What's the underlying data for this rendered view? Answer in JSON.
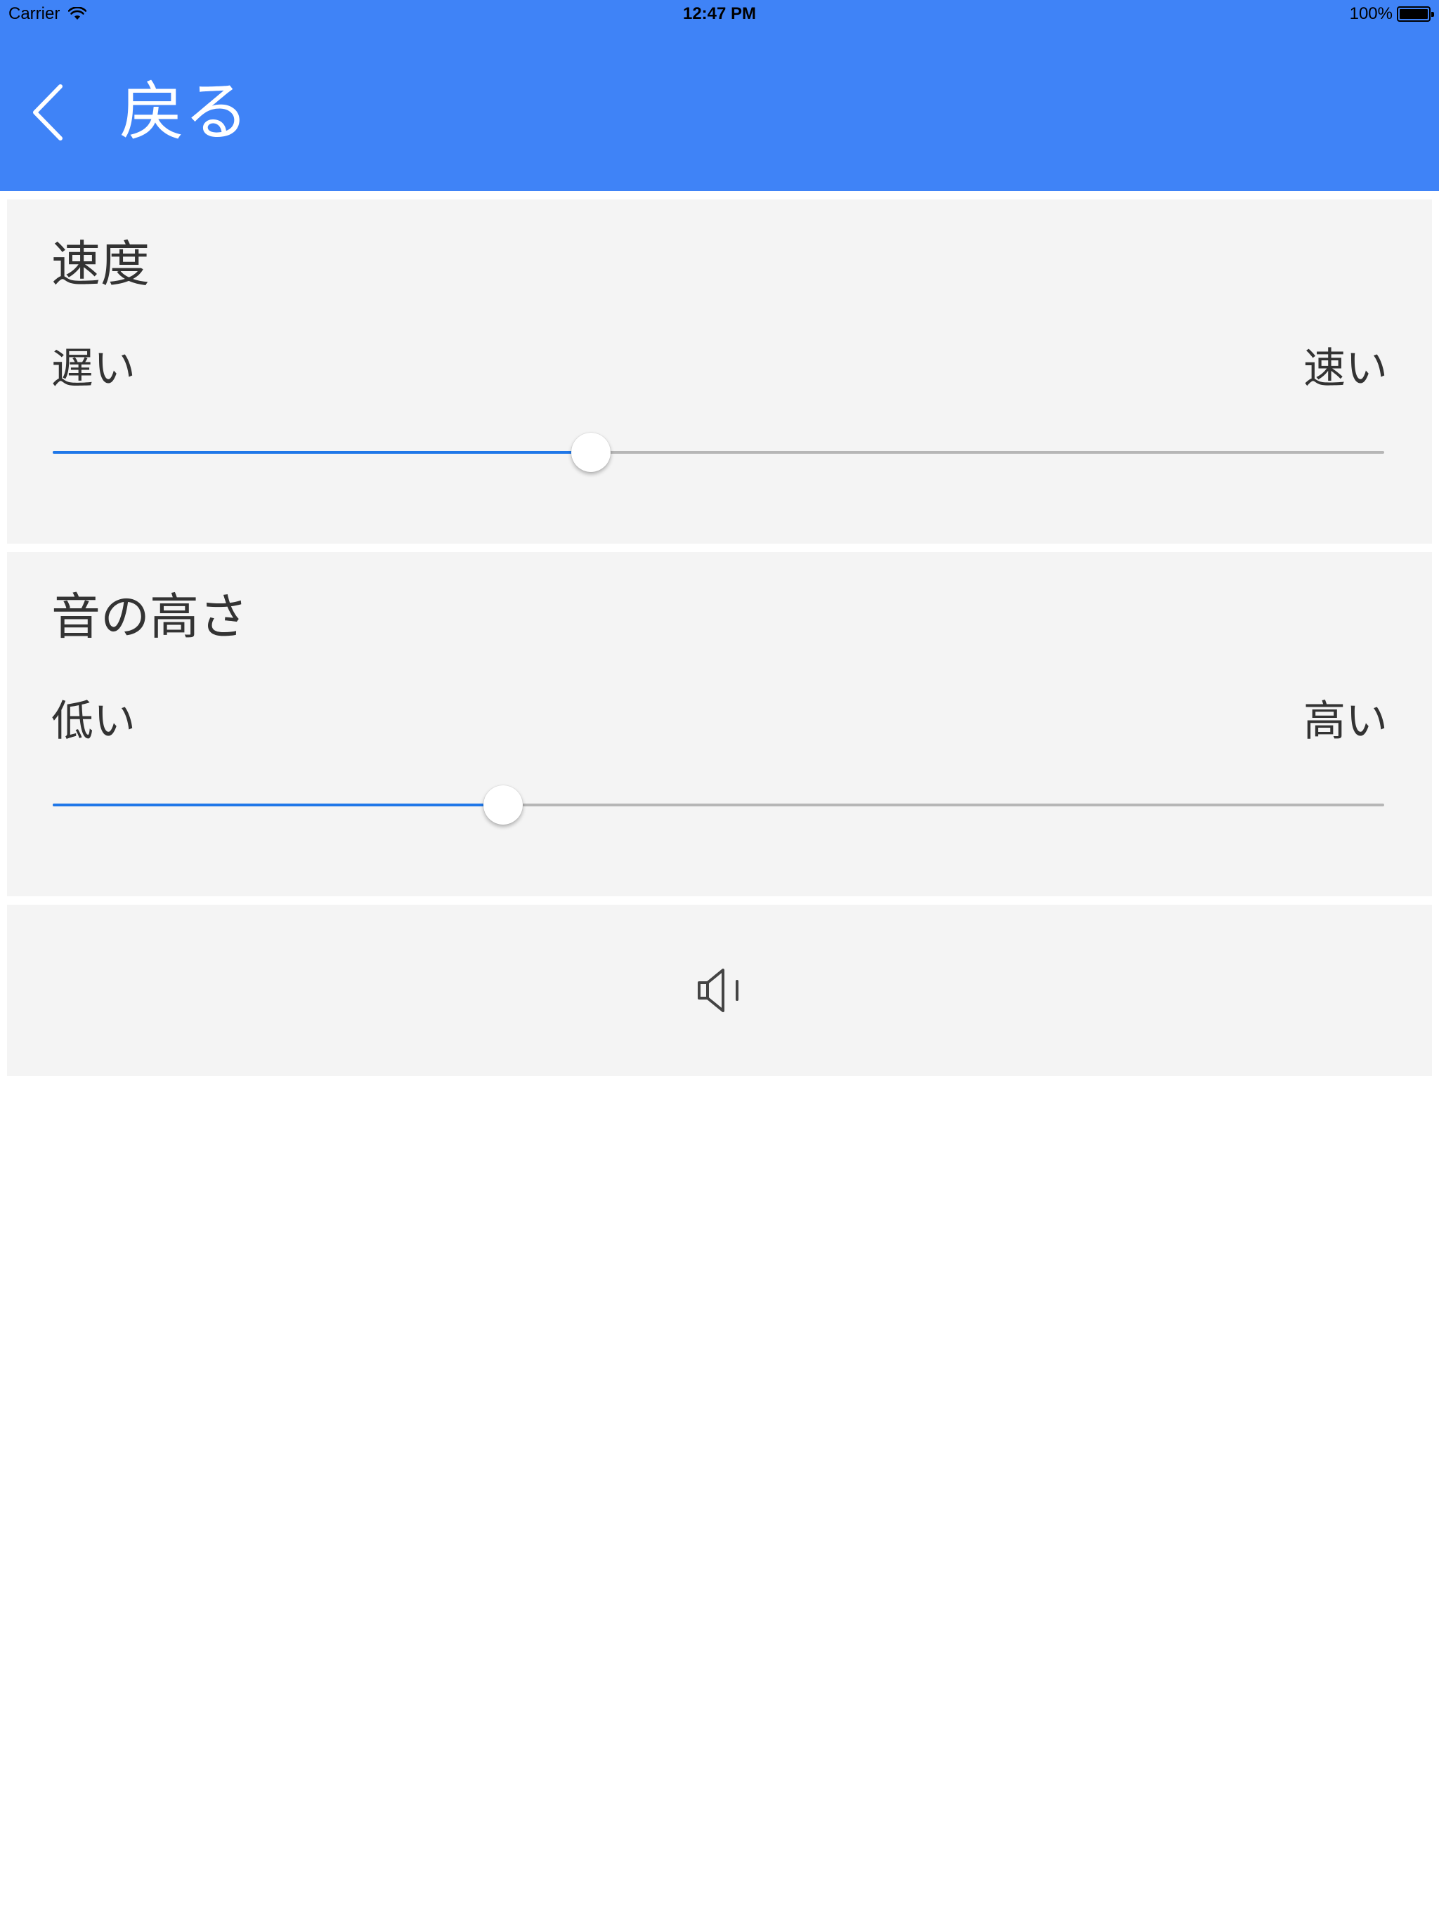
{
  "status_bar": {
    "carrier": "Carrier",
    "time": "12:47 PM",
    "battery": "100%"
  },
  "nav": {
    "back_label": "戻る",
    "back_icon": "chevron-left-icon",
    "color": "#3f83f7"
  },
  "speed": {
    "title": "速度",
    "min_label": "遅い",
    "max_label": "速い",
    "value": 0.404
  },
  "pitch": {
    "title": "音の高さ",
    "min_label": "低い",
    "max_label": "高い",
    "value": 0.338
  },
  "play": {
    "icon": "speaker-icon"
  },
  "colors": {
    "accent": "#3f83f7",
    "slider_fill": "#1f77e8",
    "slider_track": "#b6b6b6",
    "card_background": "#f4f4f4"
  }
}
